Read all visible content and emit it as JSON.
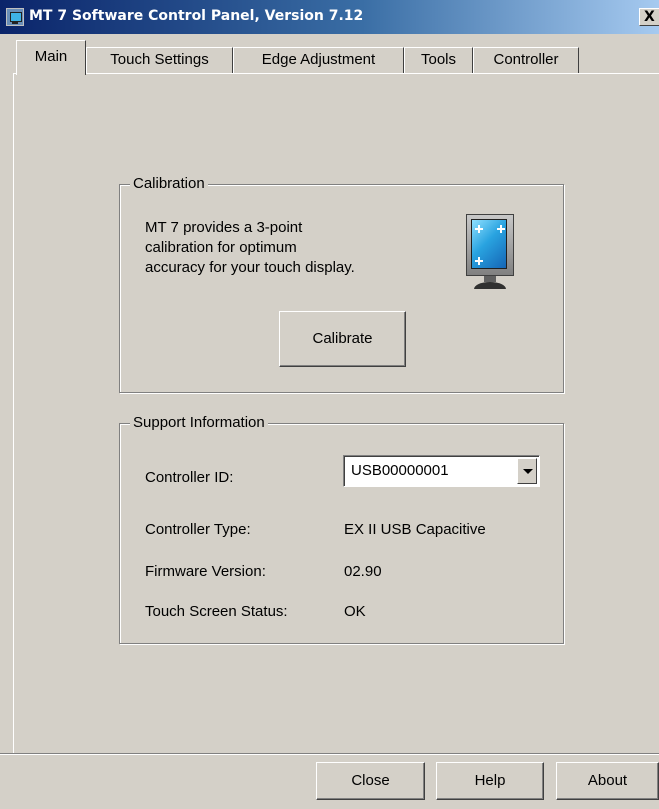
{
  "window": {
    "title": "MT 7 Software Control Panel, Version 7.12",
    "close_glyph": "X",
    "app_icon": "touch-monitor-icon"
  },
  "tabs": [
    {
      "label": "Main",
      "active": true
    },
    {
      "label": "Touch Settings",
      "active": false
    },
    {
      "label": "Edge Adjustment",
      "active": false
    },
    {
      "label": "Tools",
      "active": false
    },
    {
      "label": "Controller",
      "active": false
    }
  ],
  "calibration": {
    "legend": "Calibration",
    "text_lines": [
      "MT 7 provides a 3-point",
      "calibration for optimum",
      "accuracy for your touch display."
    ],
    "illustration_icon": "touch-monitor-icon",
    "button_label": "Calibrate"
  },
  "support": {
    "legend": "Support Information",
    "controller_id_label": "Controller ID:",
    "controller_id_value": "USB00000001",
    "controller_type_label": "Controller Type:",
    "controller_type_value": "EX II USB Capacitive",
    "firmware_label": "Firmware Version:",
    "firmware_value": "02.90",
    "status_label": "Touch Screen Status:",
    "status_value": "OK"
  },
  "footer": {
    "close_label": "Close",
    "help_label": "Help",
    "about_label": "About"
  }
}
